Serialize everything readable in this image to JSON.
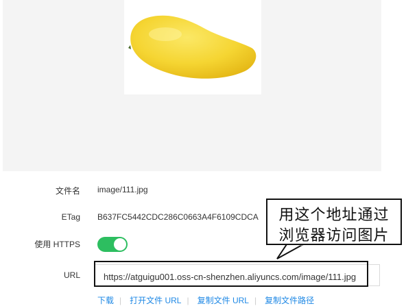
{
  "preview": {
    "image_subject": "mango",
    "background_color": "#f4f4f4"
  },
  "fields": {
    "filename_label": "文件名",
    "filename_value": "image/111.jpg",
    "etag_label": "ETag",
    "etag_value": "B637FC5442CDC286C0663A4F6109CDCA",
    "https_label": "使用 HTTPS",
    "https_enabled": true,
    "url_label": "URL",
    "url_value": "https://atguigu001.oss-cn-shenzhen.aliyuncs.com/image/111.jpg"
  },
  "actions": {
    "download": "下载",
    "open_url": "打开文件 URL",
    "copy_url": "复制文件 URL",
    "copy_path": "复制文件路径",
    "separator": "|"
  },
  "annotation": {
    "line1": "用这个地址通过",
    "line2": "浏览器访问图片"
  },
  "colors": {
    "toggle_on": "#2dbe60",
    "link": "#1e88e5"
  }
}
